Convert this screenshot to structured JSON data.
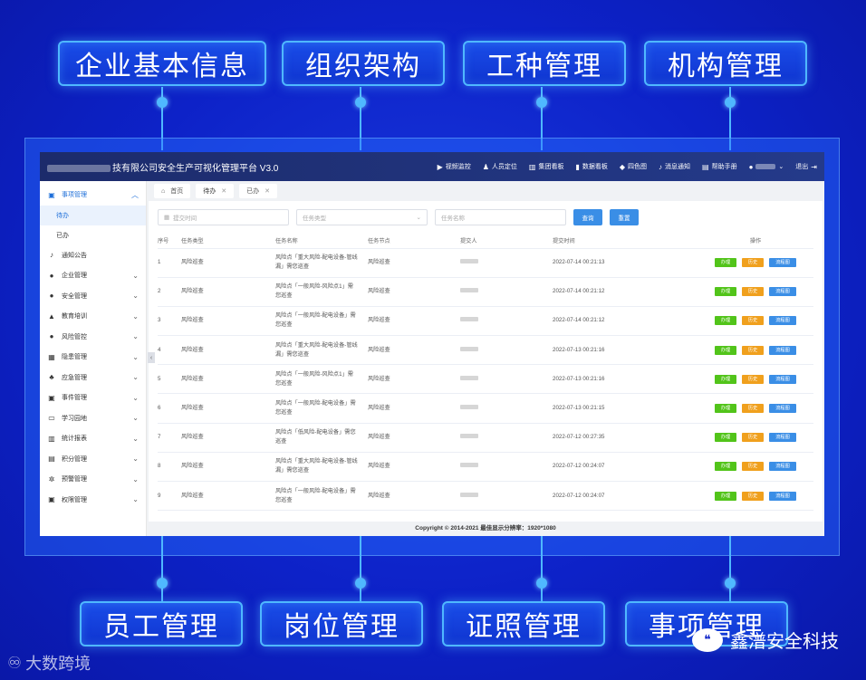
{
  "features_top": [
    "企业基本信息",
    "组织架构",
    "工种管理",
    "机构管理"
  ],
  "features_bottom": [
    "员工管理",
    "岗位管理",
    "证照管理",
    "事项管理"
  ],
  "app": {
    "title_suffix": "技有限公司安全生产可视化管理平台  V3.0",
    "nav": [
      {
        "icon": "video-icon",
        "glyph": "▶",
        "label": "视频监控"
      },
      {
        "icon": "person-location-icon",
        "glyph": "♟",
        "label": "人员定位"
      },
      {
        "icon": "map-icon",
        "glyph": "▥",
        "label": "集团看板"
      },
      {
        "icon": "bar-chart-icon",
        "glyph": "▮",
        "label": "数据看板"
      },
      {
        "icon": "cube-icon",
        "glyph": "◆",
        "label": "四色图"
      },
      {
        "icon": "bell-icon",
        "glyph": "♪",
        "label": "消息通知"
      },
      {
        "icon": "book-icon",
        "glyph": "▤",
        "label": "帮助手册"
      }
    ],
    "logout": "退出"
  },
  "sidebar": {
    "items": [
      {
        "name": "shixiang",
        "icon": "clipboard-icon",
        "glyph": "▣",
        "label": "事项管理",
        "expanded": true
      },
      {
        "name": "tongzhi",
        "icon": "bell-icon",
        "glyph": "♪",
        "label": "通知公告"
      },
      {
        "name": "qiye",
        "icon": "building-icon",
        "glyph": "●",
        "label": "企业管理"
      },
      {
        "name": "anquan",
        "icon": "shield-icon",
        "glyph": "●",
        "label": "安全管理"
      },
      {
        "name": "jiaoyu",
        "icon": "graduation-icon",
        "glyph": "▲",
        "label": "教育培训"
      },
      {
        "name": "fengxian",
        "icon": "risk-icon",
        "glyph": "●",
        "label": "风险管控"
      },
      {
        "name": "yinhuan",
        "icon": "hazard-icon",
        "glyph": "▦",
        "label": "隐患管理"
      },
      {
        "name": "yingji",
        "icon": "emergency-icon",
        "glyph": "♣",
        "label": "应急管理"
      },
      {
        "name": "shijian",
        "icon": "event-icon",
        "glyph": "▣",
        "label": "事件管理"
      },
      {
        "name": "xuexi",
        "icon": "study-icon",
        "glyph": "▭",
        "label": "学习园地"
      },
      {
        "name": "tongji",
        "icon": "stats-icon",
        "glyph": "▥",
        "label": "统计报表"
      },
      {
        "name": "jifen",
        "icon": "points-icon",
        "glyph": "▤",
        "label": "积分管理"
      },
      {
        "name": "yujing",
        "icon": "alert-icon",
        "glyph": "✲",
        "label": "预警管理"
      },
      {
        "name": "quanxian",
        "icon": "permission-icon",
        "glyph": "▣",
        "label": "权限管理"
      }
    ],
    "sub_items": [
      "待办",
      "已办"
    ]
  },
  "tabs": [
    {
      "label": "首页",
      "icon": "home-icon"
    },
    {
      "label": "待办",
      "closable": true,
      "active": true
    },
    {
      "label": "已办",
      "closable": true
    }
  ],
  "filters": {
    "time_placeholder": "提交时间",
    "type_placeholder": "任务类型",
    "name_placeholder": "任务名称",
    "search_label": "查询",
    "reset_label": "重置"
  },
  "table": {
    "headers": [
      "序号",
      "任务类型",
      "任务名称",
      "任务节点",
      "提交人",
      "提交时间",
      "操作"
    ],
    "rows": [
      {
        "no": "1",
        "type": "风险巡查",
        "name": "风险点「重大风险-配电设备-管线漏」需您巡查",
        "node": "风险巡查",
        "time": "2022-07-14 00:21:13"
      },
      {
        "no": "2",
        "type": "风险巡查",
        "name": "风险点「一般风险-风险点1」需您巡查",
        "node": "风险巡查",
        "time": "2022-07-14 00:21:12"
      },
      {
        "no": "3",
        "type": "风险巡查",
        "name": "风险点「一般风险-配电设备」需您巡查",
        "node": "风险巡查",
        "time": "2022-07-14 00:21:12"
      },
      {
        "no": "4",
        "type": "风险巡查",
        "name": "风险点「重大风险-配电设备-管线漏」需您巡查",
        "node": "风险巡查",
        "time": "2022-07-13 00:21:16"
      },
      {
        "no": "5",
        "type": "风险巡查",
        "name": "风险点「一般风险-风险点1」需您巡查",
        "node": "风险巡查",
        "time": "2022-07-13 00:21:16"
      },
      {
        "no": "6",
        "type": "风险巡查",
        "name": "风险点「一般风险-配电设备」需您巡查",
        "node": "风险巡查",
        "time": "2022-07-13 00:21:15"
      },
      {
        "no": "7",
        "type": "风险巡查",
        "name": "风险点「低风险-配电设备」需您巡查",
        "node": "风险巡查",
        "time": "2022-07-12 00:27:35"
      },
      {
        "no": "8",
        "type": "风险巡查",
        "name": "风险点「重大风险-配电设备-管线漏」需您巡查",
        "node": "风险巡查",
        "time": "2022-07-12 00:24:07"
      },
      {
        "no": "9",
        "type": "风险巡查",
        "name": "风险点「一般风险-配电设备」需您巡查",
        "node": "风险巡查",
        "time": "2022-07-12 00:24:07"
      }
    ],
    "actions": [
      "办理",
      "历史",
      "流程图"
    ]
  },
  "footer": "Copyright © 2014-2021 最佳显示分辨率：1920*1080",
  "watermark_left": "大数跨境",
  "watermark_right": "鑫潽安全科技"
}
